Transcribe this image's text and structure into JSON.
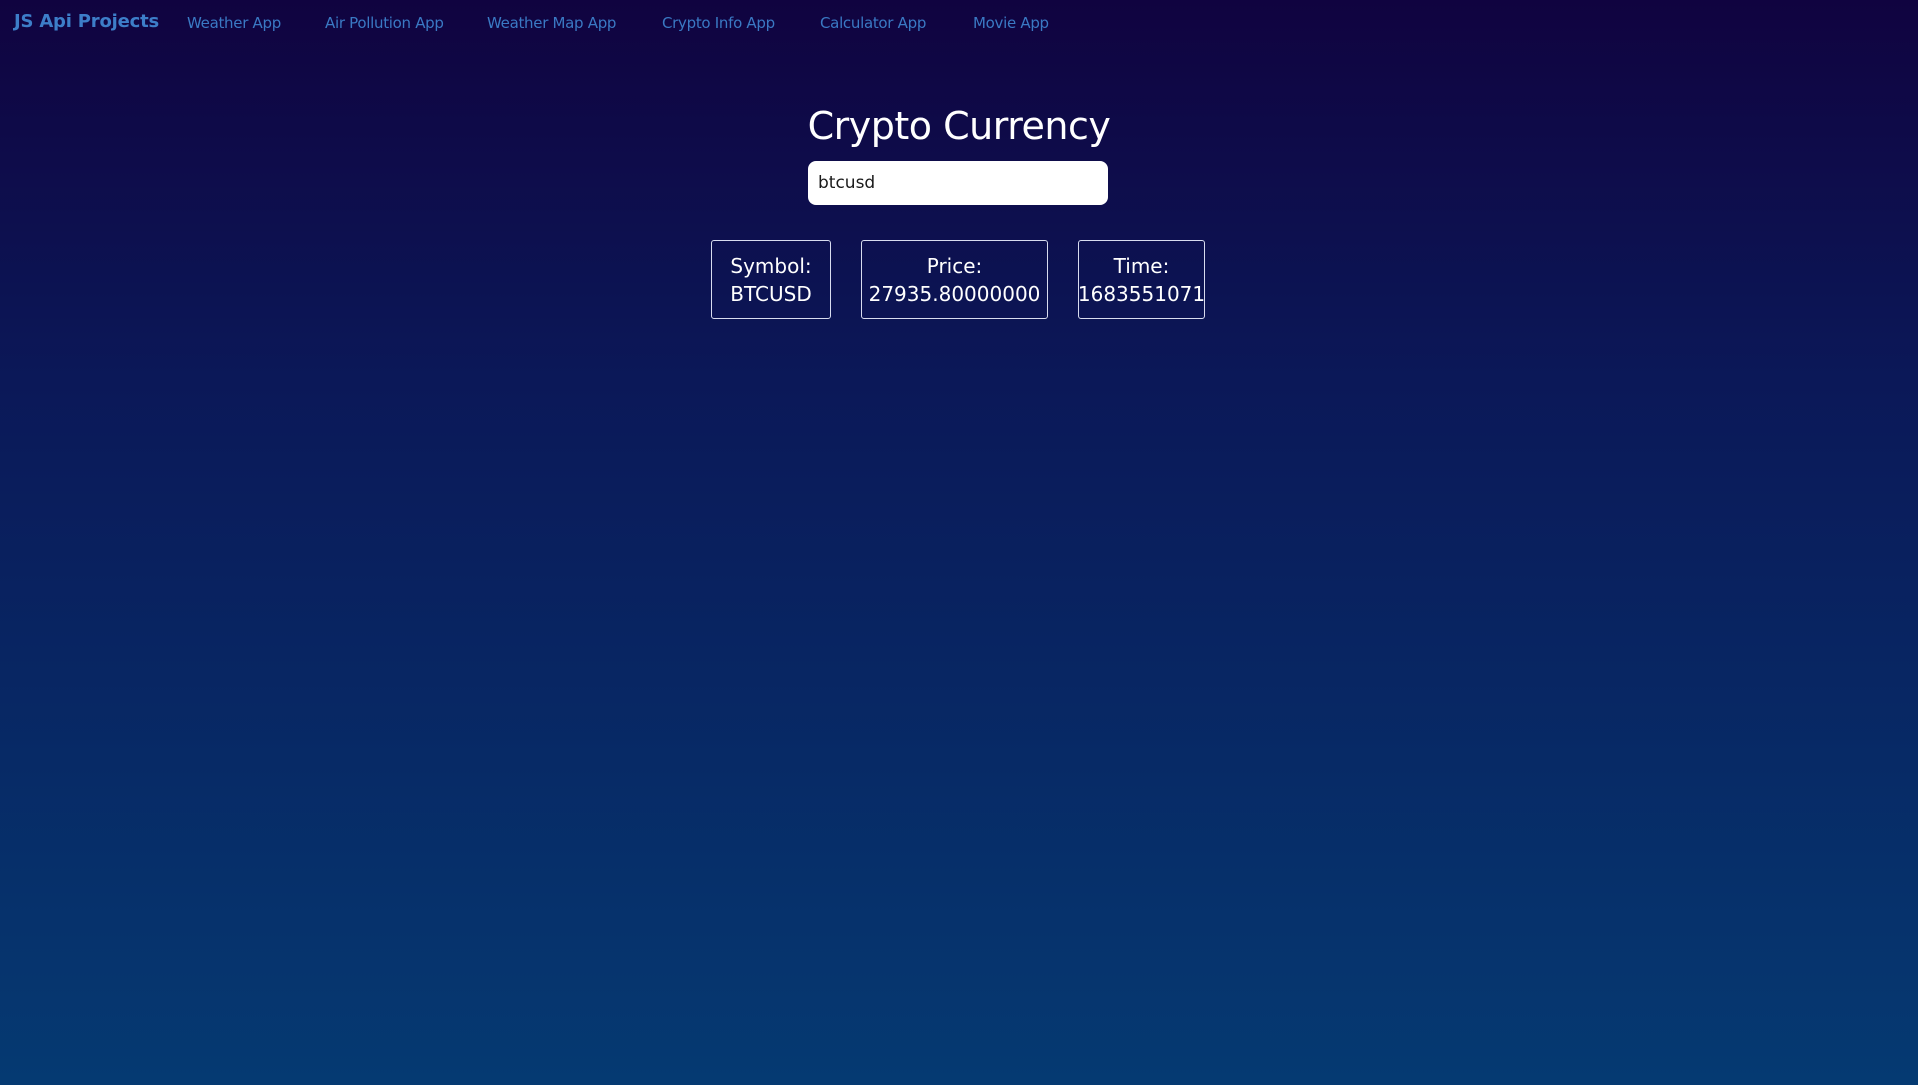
{
  "nav": {
    "brand": "JS Api Projects",
    "links": [
      {
        "label": "Weather App"
      },
      {
        "label": "Air Pollution App"
      },
      {
        "label": "Weather Map App"
      },
      {
        "label": "Crypto Info App"
      },
      {
        "label": "Calculator App"
      },
      {
        "label": "Movie App"
      }
    ]
  },
  "main": {
    "title": "Crypto Currency",
    "search": {
      "value": "btcusd",
      "placeholder": ""
    },
    "info": {
      "symbol": {
        "label": "Symbol:",
        "value": "BTCUSD"
      },
      "price": {
        "label": "Price:",
        "value": "27935.80000000"
      },
      "time": {
        "label": "Time:",
        "value": "1683551071"
      }
    }
  },
  "colors": {
    "background_top": "#100340",
    "background_bottom": "#053a72",
    "nav_link": "#3a79c4",
    "text": "#ffffff"
  }
}
